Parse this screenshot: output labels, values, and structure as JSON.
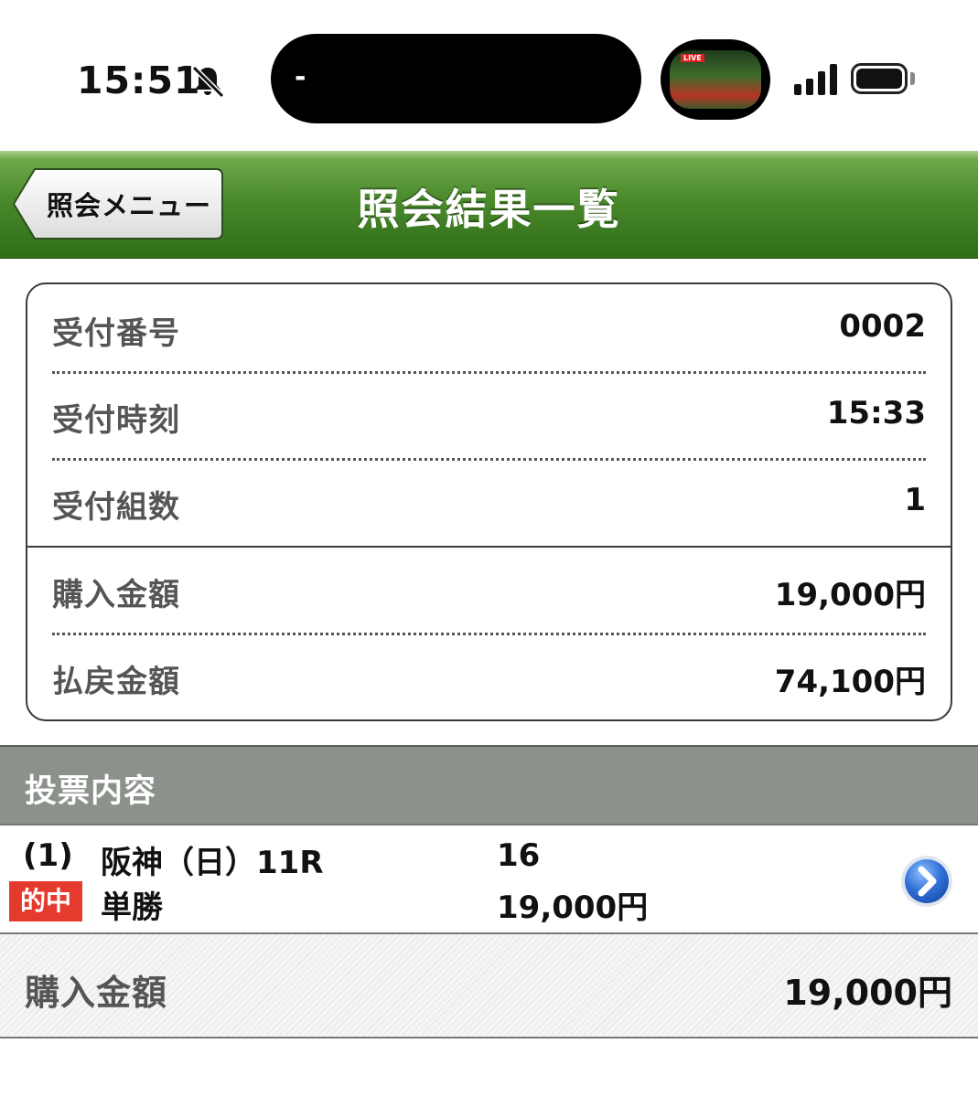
{
  "status_bar": {
    "time": "15:51",
    "island_text": "-",
    "pip_badge": "LIVE"
  },
  "header": {
    "back_label": "照会メニュー",
    "title": "照会結果一覧",
    "accent_color": "#3f7d25"
  },
  "summary": {
    "rows": [
      {
        "label": "受付番号",
        "value": "0002"
      },
      {
        "label": "受付時刻",
        "value": "15:33"
      },
      {
        "label": "受付組数",
        "value": "1"
      },
      {
        "label": "購入金額",
        "value": "19,000円"
      },
      {
        "label": "払戻金額",
        "value": "74,100円"
      }
    ]
  },
  "section": {
    "title": "投票内容"
  },
  "bet": {
    "index": "(1)",
    "race": "阪神（日）11R",
    "horse": "16",
    "badge": "的中",
    "badge_color": "#e53b2f",
    "type": "単勝",
    "amount": "19,000円"
  },
  "total": {
    "label": "購入金額",
    "value": "19,000円"
  }
}
